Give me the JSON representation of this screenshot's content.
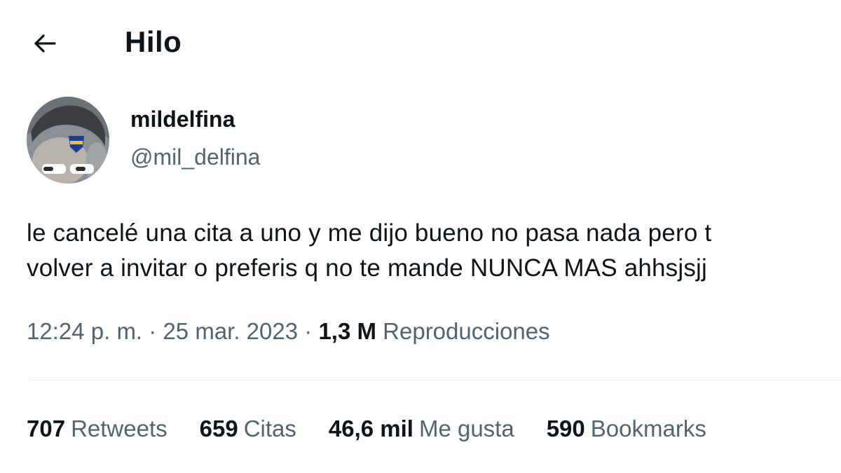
{
  "header": {
    "title": "Hilo",
    "back_icon": "arrow-left-icon"
  },
  "tweet": {
    "author": {
      "display_name": "mildelfina",
      "handle": "@mil_delfina"
    },
    "text_lines": [
      "le cancelé una cita a uno y me dijo bueno no pasa nada pero t",
      "volver a invitar o preferis q no te mande NUNCA MAS ahhsjsjj"
    ],
    "time": "12:24 p. m.",
    "date": "25 mar. 2023",
    "views_count": "1,3 M",
    "views_label": "Reproducciones"
  },
  "stats": [
    {
      "count": "707",
      "label": "Retweets"
    },
    {
      "count": "659",
      "label": "Citas"
    },
    {
      "count": "46,6 mil",
      "label": "Me gusta"
    },
    {
      "count": "590",
      "label": "Bookmarks"
    }
  ],
  "colors": {
    "text": "#0f1419",
    "secondary": "#536471",
    "divider": "#eff3f4"
  }
}
